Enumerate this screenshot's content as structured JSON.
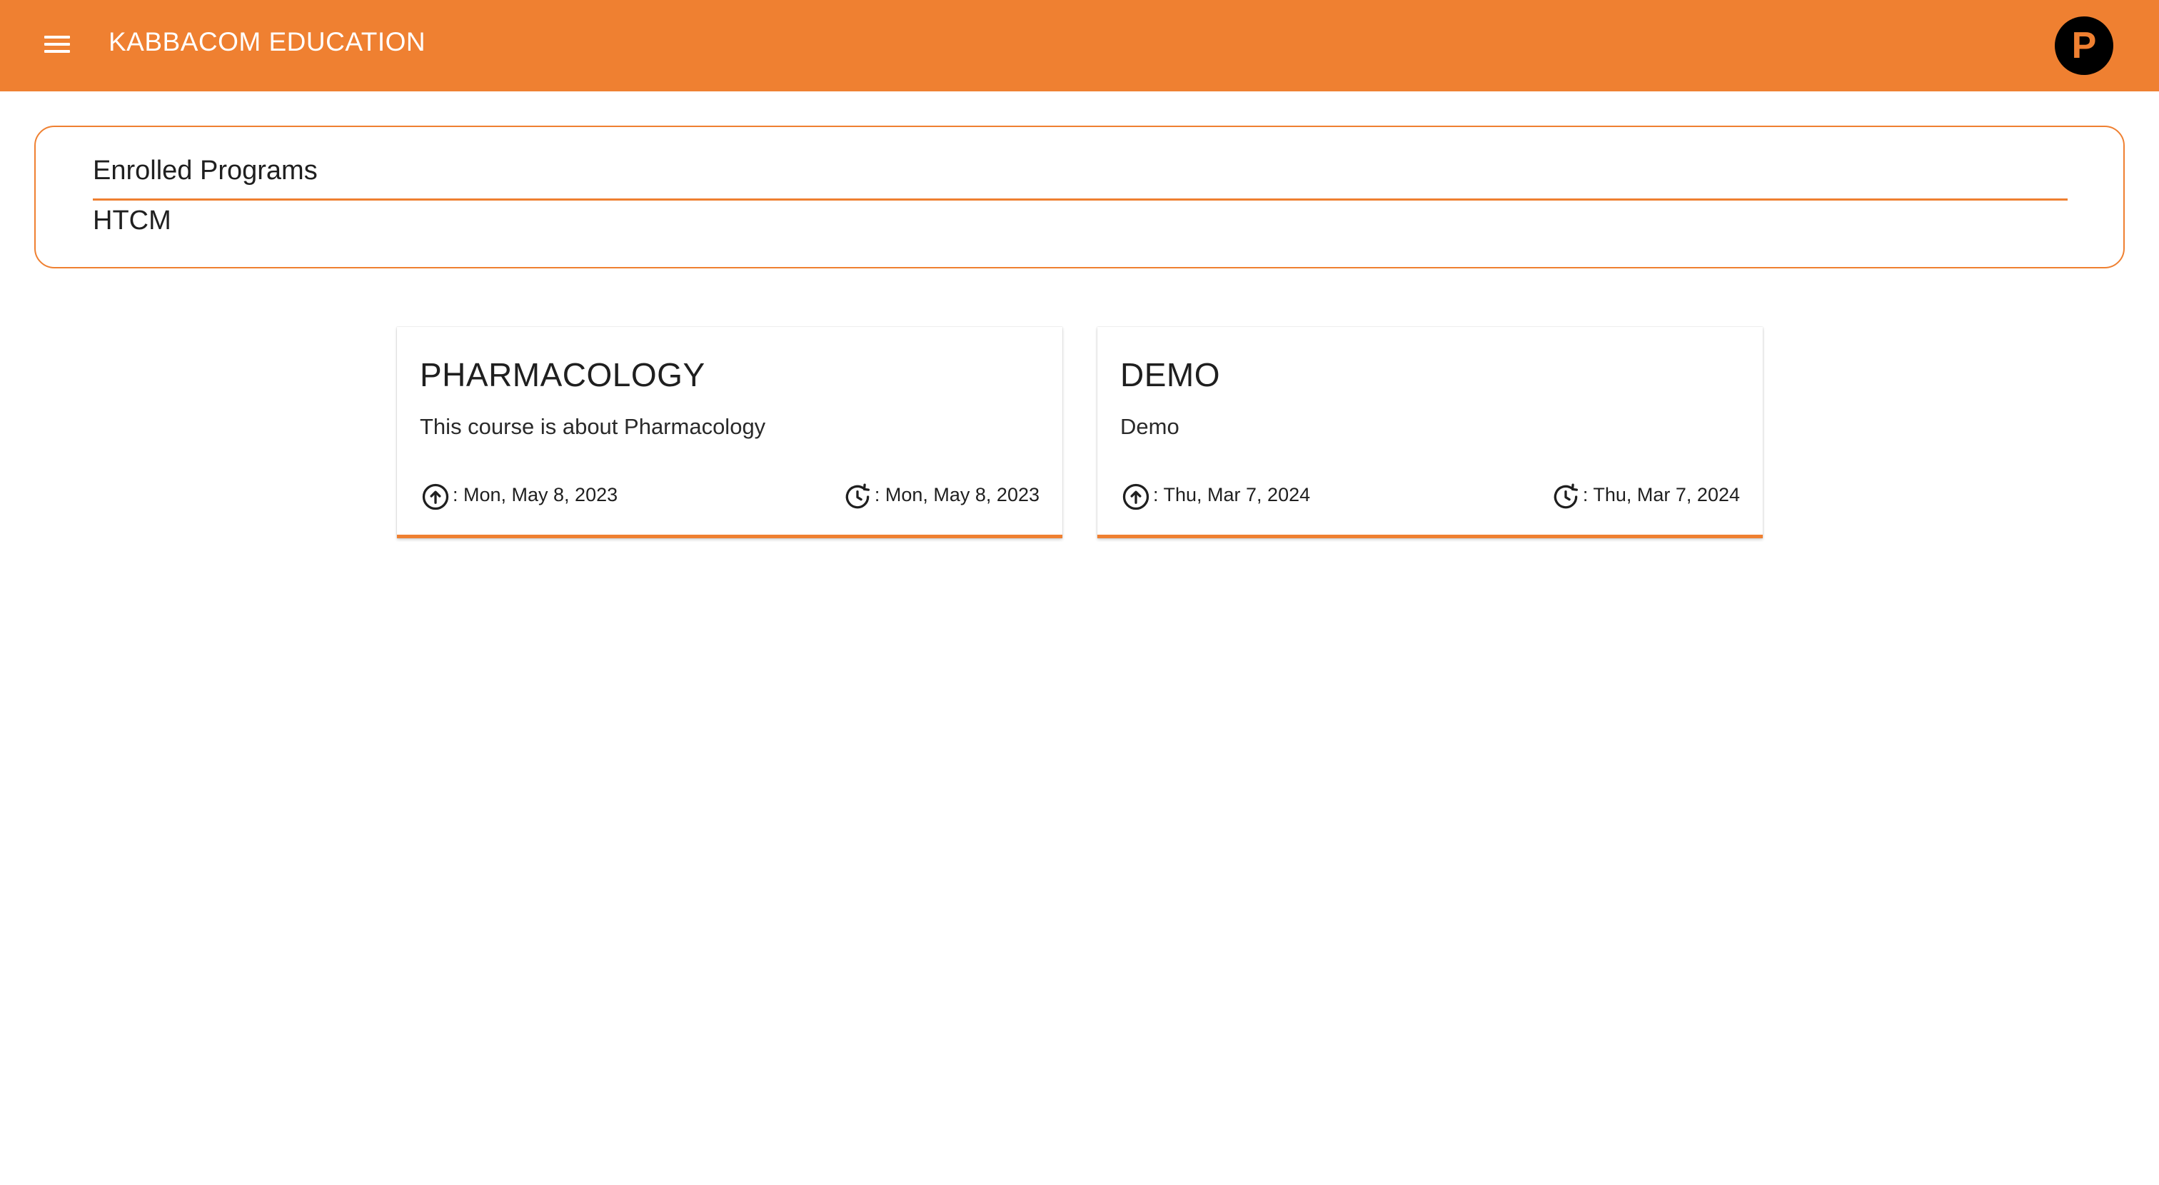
{
  "header": {
    "app_title": "KABBACOM EDUCATION",
    "menu_icon": "hamburger-menu-icon",
    "avatar_letter": "P",
    "brand_color": "#ef8031"
  },
  "enrolled": {
    "title": "Enrolled Programs",
    "program": "HTCM"
  },
  "courses": [
    {
      "title": "PHARMACOLOGY",
      "description": "This course is about Pharmacology",
      "created_label": ": Mon, May 8, 2023",
      "updated_label": ": Mon, May 8, 2023",
      "created_icon": "upload-circle-icon",
      "updated_icon": "history-update-icon"
    },
    {
      "title": "DEMO",
      "description": "Demo",
      "created_label": ": Thu, Mar 7, 2024",
      "updated_label": ": Thu, Mar 7, 2024",
      "created_icon": "upload-circle-icon",
      "updated_icon": "history-update-icon"
    }
  ]
}
